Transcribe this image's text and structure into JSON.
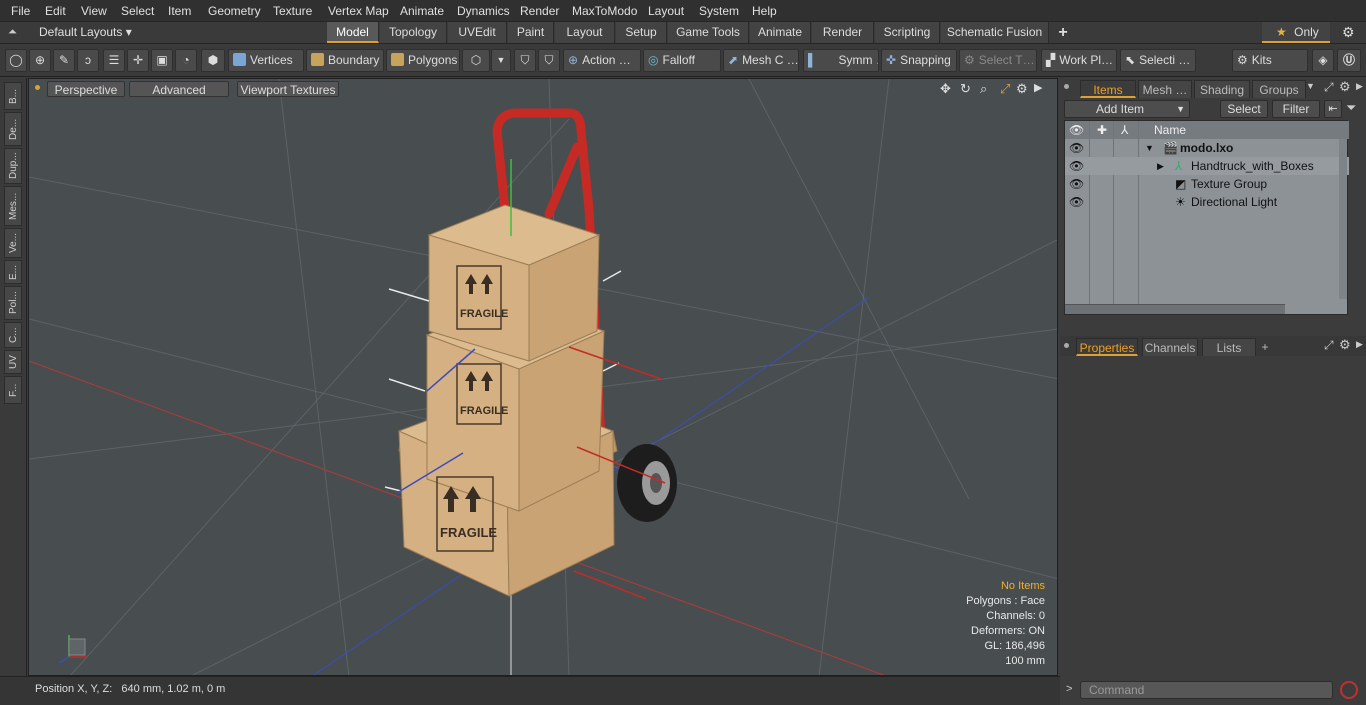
{
  "menu": [
    "File",
    "Edit",
    "View",
    "Select",
    "Item",
    "Geometry",
    "Texture",
    "Vertex Map",
    "Animate",
    "Dynamics",
    "Render",
    "MaxToModo",
    "Layout",
    "System",
    "Help"
  ],
  "layouts": {
    "label": "Default Layouts ▾"
  },
  "tabs": [
    "Model",
    "Topology",
    "UVEdit",
    "Paint",
    "Layout",
    "Setup",
    "Game Tools",
    "Animate",
    "Render",
    "Scripting",
    "Schematic Fusion",
    "+"
  ],
  "only": {
    "label": "Only"
  },
  "toolbar": {
    "vertices": "Vertices",
    "boundary": "Boundary",
    "polygons": "Polygons",
    "action": "Action …",
    "falloff": "Falloff",
    "mesh": "Mesh C …",
    "symm": "Symm …",
    "snapping": "Snapping",
    "select_t": "Select T…",
    "workpl": "Work Pl…",
    "selecti": "Selecti …",
    "kits": "Kits"
  },
  "lefttabs": [
    "B...",
    "De...",
    "Dup...",
    "Mes...",
    "Ve...",
    "E...",
    "Pol...",
    "C...",
    "UV",
    "F..."
  ],
  "viewport": {
    "view": "Perspective",
    "advanced": "Advanced",
    "textures": "Viewport Textures",
    "info": {
      "no_items": "No Items",
      "polygons": "Polygons : Face",
      "channels": "Channels: 0",
      "deformers": "Deformers: ON",
      "gl": "GL: 186,496",
      "scale": "100 mm"
    },
    "labels": {
      "fragile": "FRAGILE"
    }
  },
  "status": {
    "position": "Position X, Y, Z:   640 mm, 1.02 m, 0 m"
  },
  "panel": {
    "tabs": [
      "Items",
      "Mesh …",
      "Shading",
      "Groups"
    ],
    "add_item": "Add Item",
    "select": "Select",
    "filter": "Filter",
    "name_header": "Name",
    "items": [
      {
        "label": "modo.lxo",
        "indent": 0
      },
      {
        "label": "Handtruck_with_Boxes",
        "indent": 1
      },
      {
        "label": "Texture Group",
        "indent": 1
      },
      {
        "label": "Directional Light",
        "indent": 1
      }
    ],
    "props_tabs": [
      "Properties",
      "Channels",
      "Lists",
      "+"
    ]
  },
  "command": {
    "placeholder": "Command"
  },
  "colors": {
    "accent": "#e0a030",
    "box": "#d1ad7e",
    "cart": "#c52a25",
    "viewport": "#484d50"
  }
}
